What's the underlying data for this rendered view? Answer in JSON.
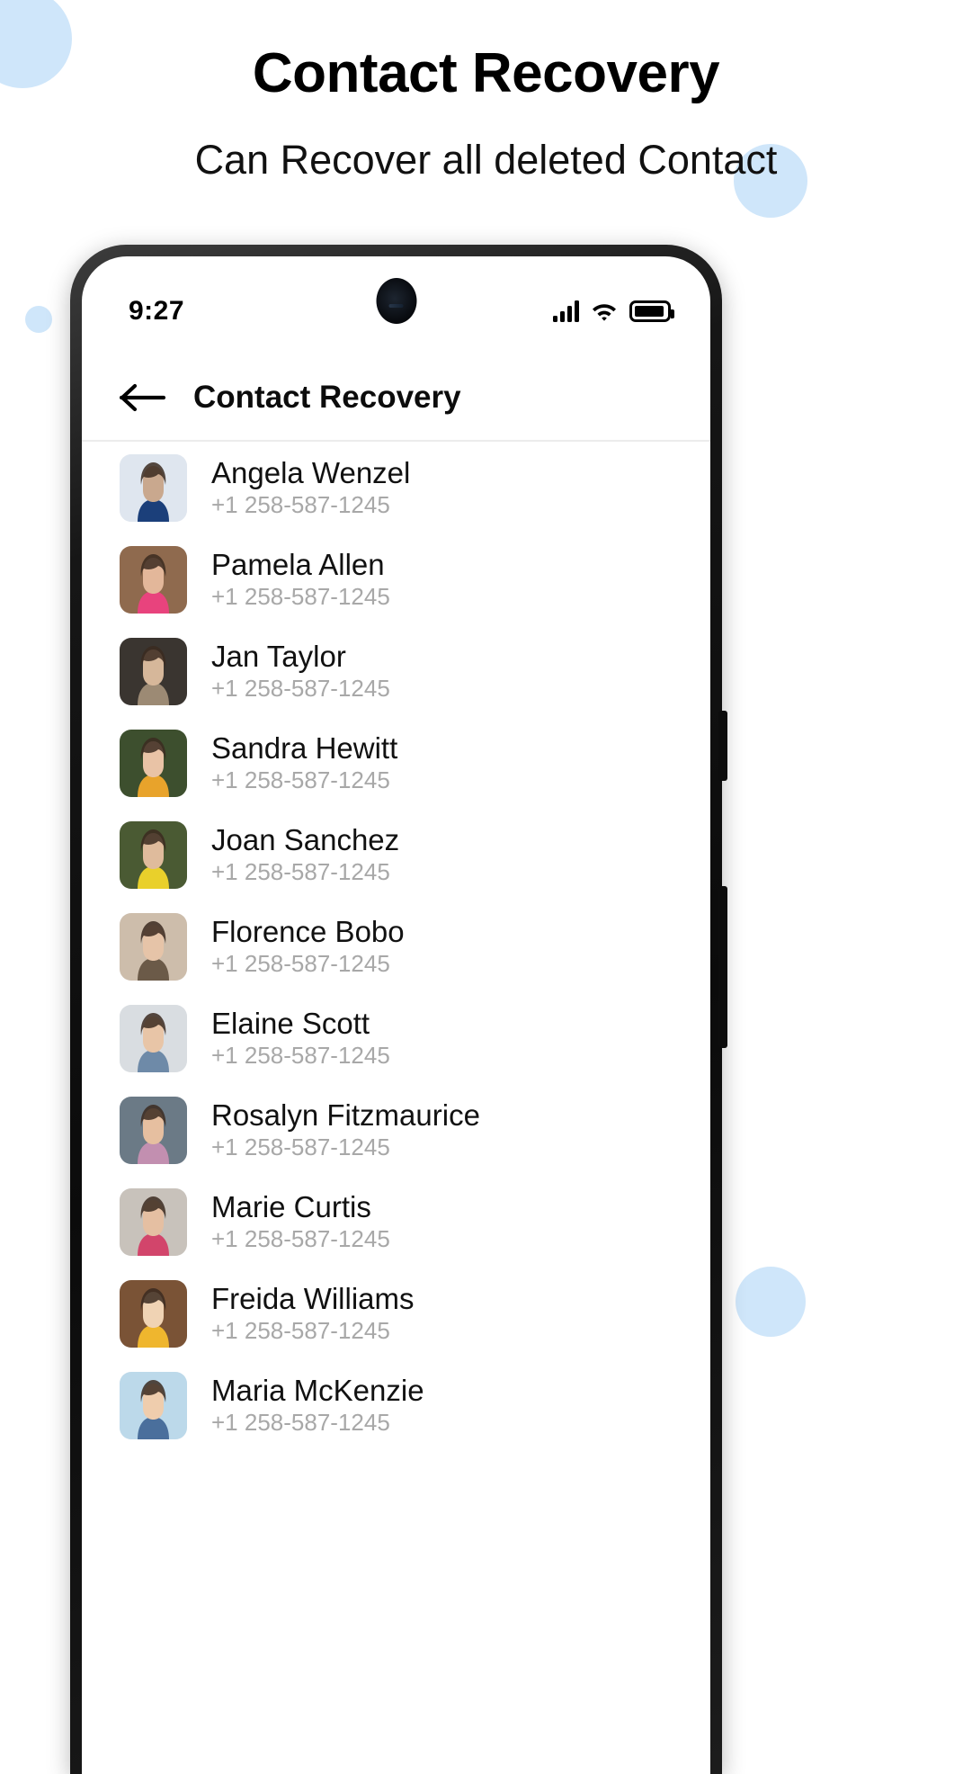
{
  "promo": {
    "title": "Contact Recovery",
    "subtitle": "Can Recover all deleted Contact"
  },
  "phone": {
    "statusbar": {
      "time": "9:27",
      "icons": [
        "signal-icon",
        "wifi-icon",
        "battery-icon"
      ],
      "battery_full": true,
      "signal_bars": 4
    },
    "appbar": {
      "back_icon": "back-arrow-icon",
      "title": "Contact Recovery"
    }
  },
  "colors": {
    "accent_blue": "#cfe6fa",
    "name_text": "#111111",
    "phone_text": "#a8a8a8",
    "divider": "#ececec"
  },
  "contacts": [
    {
      "name": "Angela Wenzel",
      "phone": "+1 258-587-1245",
      "avatar_bg": "#dfe6ef",
      "avatar_tone": "#c9a88e",
      "avatar_accent": "#1b3f7a"
    },
    {
      "name": "Pamela Allen",
      "phone": "+1 258-587-1245",
      "avatar_bg": "#8f6a4e",
      "avatar_tone": "#e3b79a",
      "avatar_accent": "#e8437d"
    },
    {
      "name": "Jan Taylor",
      "phone": "+1 258-587-1245",
      "avatar_bg": "#3a3530",
      "avatar_tone": "#d6b79a",
      "avatar_accent": "#9c8a74"
    },
    {
      "name": "Sandra Hewitt",
      "phone": "+1 258-587-1245",
      "avatar_bg": "#3d4f2e",
      "avatar_tone": "#e9c3a6",
      "avatar_accent": "#e8a32b"
    },
    {
      "name": "Joan Sanchez",
      "phone": "+1 258-587-1245",
      "avatar_bg": "#4a5a33",
      "avatar_tone": "#dfbb9c",
      "avatar_accent": "#e9d02b"
    },
    {
      "name": "Florence Bobo",
      "phone": "+1 258-587-1245",
      "avatar_bg": "#cdbdab",
      "avatar_tone": "#e6c4a8",
      "avatar_accent": "#6b5a48"
    },
    {
      "name": "Elaine Scott",
      "phone": "+1 258-587-1245",
      "avatar_bg": "#d9dde1",
      "avatar_tone": "#e8c5a7",
      "avatar_accent": "#6e8aa8"
    },
    {
      "name": "Rosalyn Fitzmaurice",
      "phone": "+1 258-587-1245",
      "avatar_bg": "#6b7a86",
      "avatar_tone": "#e6bfa0",
      "avatar_accent": "#c28fb0"
    },
    {
      "name": "Marie Curtis",
      "phone": "+1 258-587-1245",
      "avatar_bg": "#c8c2bb",
      "avatar_tone": "#e5bfa2",
      "avatar_accent": "#d2456b"
    },
    {
      "name": "Freida Williams",
      "phone": "+1 258-587-1245",
      "avatar_bg": "#7a5336",
      "avatar_tone": "#f0d3b4",
      "avatar_accent": "#efb62e"
    },
    {
      "name": "Maria McKenzie",
      "phone": "+1 258-587-1245",
      "avatar_bg": "#bcd9ea",
      "avatar_tone": "#efcdad",
      "avatar_accent": "#4a6f9c"
    }
  ]
}
